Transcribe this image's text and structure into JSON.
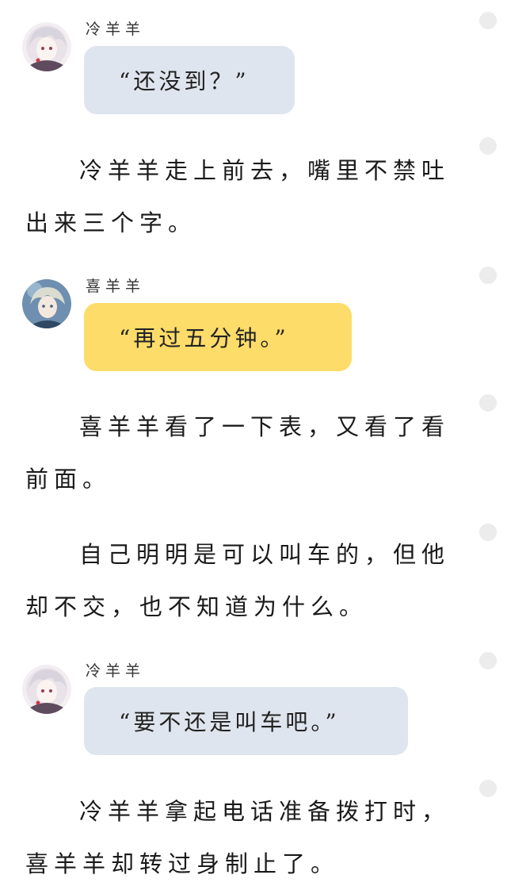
{
  "messages": [
    {
      "speaker": "冷羊羊",
      "text": "“还没到？”",
      "bubble_color": "#dfe5ee",
      "avatar": "white-haired-character-avatar"
    },
    {
      "speaker": "喜羊羊",
      "text": "“再过五分钟。”",
      "bubble_color": "#fddc6a",
      "avatar": "blond-character-avatar"
    },
    {
      "speaker": "冷羊羊",
      "text": "“要不还是叫车吧。”",
      "bubble_color": "#dfe5ee",
      "avatar": "white-haired-character-avatar"
    }
  ],
  "paragraphs": [
    "冷羊羊走上前去，嘴里不禁吐出来三个字。",
    "喜羊羊看了一下表，又看了看前面。",
    "自己明明是可以叫车的，但他却不交，也不知道为什么。",
    "冷羊羊拿起电话准备拨打时，喜羊羊却转过身制止了。"
  ]
}
